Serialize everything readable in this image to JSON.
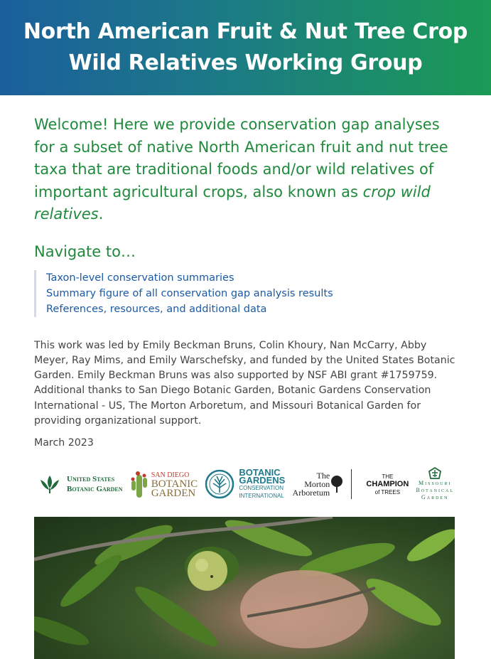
{
  "header": {
    "title_line1": "North American Fruit & Nut Tree Crop",
    "title_line2": "Wild Relatives Working Group"
  },
  "intro": {
    "text": "Welcome! Here we provide conservation gap analyses for a subset of native North American fruit and nut tree taxa that are traditional foods and/or wild relatives of important agricultural crops, also known as ",
    "emphasis": "crop wild relatives",
    "end": "."
  },
  "navigate": {
    "heading": "Navigate to…",
    "links": [
      "Taxon-level conservation summaries",
      "Summary figure of all conservation gap analysis results",
      "References, resources, and additional data"
    ]
  },
  "acknowledgement": "This work was led by Emily Beckman Bruns, Colin Khoury, Nan McCarry, Abby Meyer, Ray Mims, and Emily Warschefsky, and funded by the United States Botanic Garden. Emily Beckman Bruns was also supported by NSF ABI grant #1759759. Additional thanks to San Diego Botanic Garden, Botanic Gardens Conservation International - US, The Morton Arboretum, and Missouri Botanical Garden for providing organizational support.",
  "date": "March 2023",
  "logos": {
    "usbg": [
      "United States",
      "Botanic Garden"
    ],
    "sdbg": [
      "SAN DIEGO",
      "BOTANIC",
      "GARDEN"
    ],
    "bgci": [
      "BOTANIC",
      "GARDENS",
      "CONSERVATION",
      "INTERNATIONAL"
    ],
    "morton": [
      "The",
      "Morton",
      "Arboretum"
    ],
    "champion": [
      "THE",
      "CHAMPION",
      "of TREES"
    ],
    "mbg": [
      "Missouri",
      "Botanical",
      "Garden"
    ]
  },
  "colors": {
    "accent_green": "#1f8a3b",
    "link_blue": "#1a5aa6",
    "banner_start": "#1b5f9c",
    "banner_end": "#1b9a55"
  },
  "photo": {
    "icon": "walnut-branch-photo"
  }
}
